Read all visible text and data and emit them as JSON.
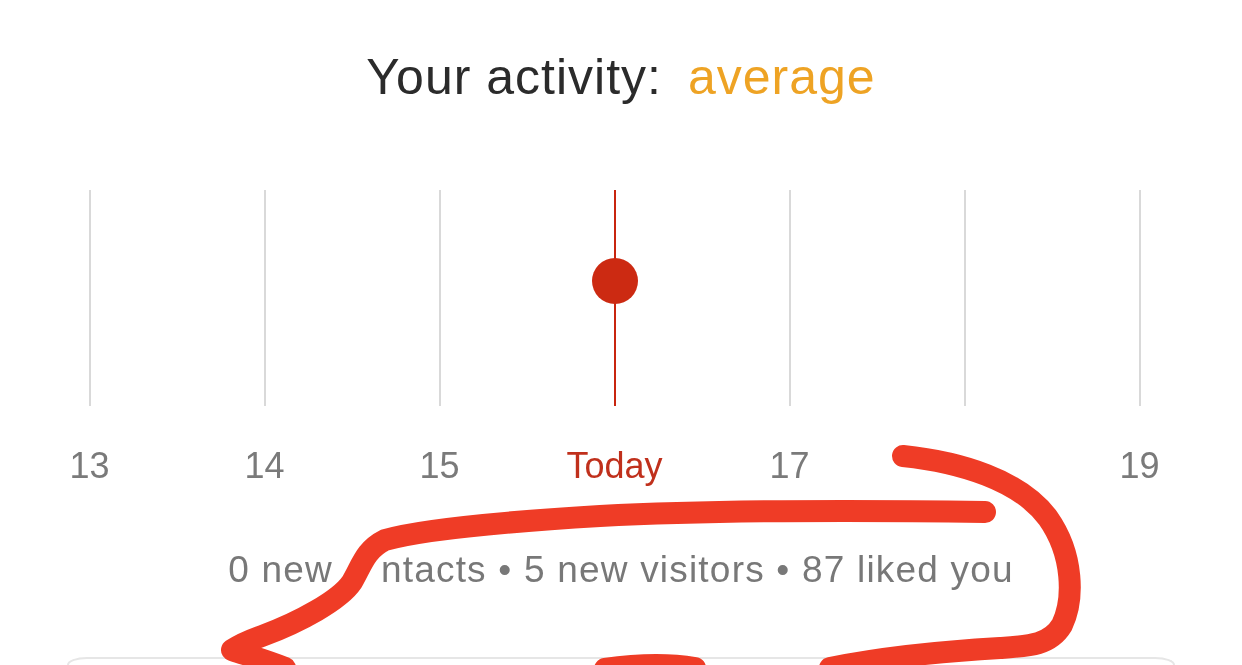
{
  "title": {
    "label": "Your activity:",
    "value": "average"
  },
  "timeline": {
    "days": [
      {
        "label": "13",
        "selected": false
      },
      {
        "label": "14",
        "selected": false
      },
      {
        "label": "15",
        "selected": false
      },
      {
        "label": "Today",
        "selected": true
      },
      {
        "label": "17",
        "selected": false
      },
      {
        "selected": false
      },
      {
        "label": "19",
        "selected": false
      }
    ]
  },
  "summary": [
    "0 new",
    "ntacts • 5 new visitors • 87 liked you"
  ]
}
